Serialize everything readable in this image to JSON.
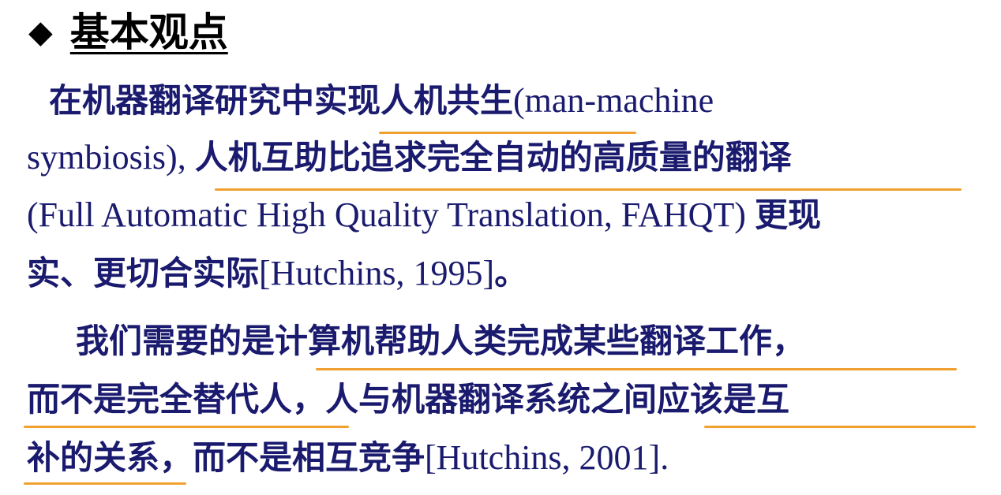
{
  "heading": {
    "bullet": "◆",
    "title": "基本观点"
  },
  "para1": {
    "l1_zh_a": "在机器翻译研究中实现人机共生",
    "l1_en": "(man-machine",
    "l2_en": "symbiosis), ",
    "l2_zh": "人机互助比追求完全自动的高质量的翻译",
    "l3_en": "(Full Automatic High Quality Translation, FAHQT) ",
    "l3_zh": "更现",
    "l4_zh": "实、更切合实际",
    "l4_en": "[Hutchins, 1995]",
    "l4_end": "。"
  },
  "para2": {
    "l1_zh": "我们需要的是计算机帮助人类完成某些翻译工作，",
    "l2_zh": "而不是完全替代人，人与机器翻译系统之间应该是互",
    "l3_zh": "补的关系，而不是相互竞争",
    "l3_en": "[Hutchins, 2001]."
  },
  "colors": {
    "text": "#1a1a6e",
    "underline": "#f0a030",
    "heading": "#000000"
  }
}
